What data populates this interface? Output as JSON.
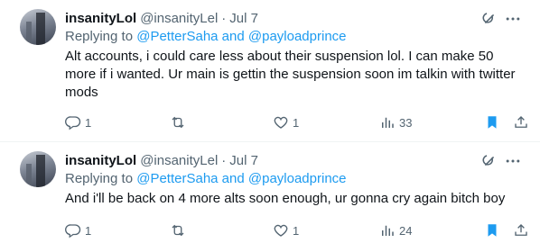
{
  "tweets": [
    {
      "display_name": "insanityLol",
      "handle": "@insanityLel",
      "separator": "·",
      "date": "Jul 7",
      "replying_prefix": "Replying to",
      "mention_1": "@PetterSaha",
      "and_word": "and",
      "mention_2": "@payloadprince",
      "text": "Alt accounts, i could care less about their suspension lol. I can make 50 more if i wanted. Ur main is gettin the suspension soon im talkin with twitter mods",
      "reply_count": "1",
      "retweet_count": "",
      "like_count": "1",
      "view_count": "33",
      "bookmarked": true
    },
    {
      "display_name": "insanityLol",
      "handle": "@insanityLel",
      "separator": "·",
      "date": "Jul 7",
      "replying_prefix": "Replying to",
      "mention_1": "@PetterSaha",
      "and_word": "and",
      "mention_2": "@payloadprince",
      "text": "And i'll be back on 4 more alts soon enough, ur gonna cry again bitch boy",
      "reply_count": "1",
      "retweet_count": "",
      "like_count": "1",
      "view_count": "24",
      "bookmarked": true
    }
  ],
  "icons": {
    "grok": "grok-icon",
    "more": "more-icon",
    "reply": "reply-icon",
    "retweet": "retweet-icon",
    "like": "heart-icon",
    "views": "views-icon",
    "bookmark": "bookmark-icon",
    "share": "share-icon"
  },
  "colors": {
    "accent": "#1d9bf0",
    "text": "#0f1419",
    "muted": "#536471",
    "divider": "#eff3f4"
  }
}
